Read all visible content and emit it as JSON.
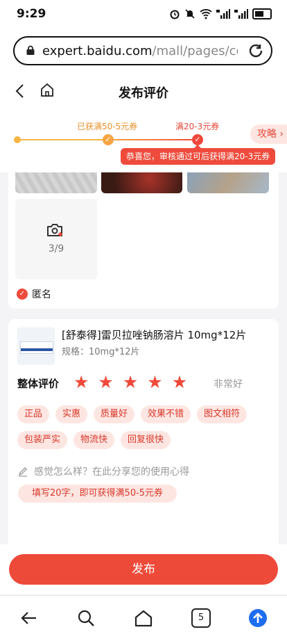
{
  "status_bar": {
    "time": "9:29",
    "icons": [
      "alarm-icon",
      "mute-icon",
      "wifi-icon",
      "signal-4g-icon",
      "signal-4g-icon",
      "battery-icon"
    ]
  },
  "browser": {
    "url_domain": "expert.baidu.com",
    "url_path": "/mall/pages/com"
  },
  "header": {
    "title": "发布评价"
  },
  "progress": {
    "label_1": "已获满50-5元券",
    "label_2": "满20-3元券",
    "tip": "恭喜您，审核通过可后获得满20-3元券",
    "guide": "攻略",
    "guide_arrow": "›",
    "check": "✓"
  },
  "upload": {
    "count": "3/9"
  },
  "anonymous": {
    "label": "匿名",
    "check": "✓"
  },
  "product": {
    "name": "[舒泰得]雷贝拉唑钠肠溶片 10mg*12片",
    "spec": "规格：10mg*12片"
  },
  "rating": {
    "label": "整体评价",
    "stars": 5,
    "star_glyph": "★",
    "text": "非常好"
  },
  "tags": [
    "正品",
    "实惠",
    "质量好",
    "效果不错",
    "图文相符",
    "包装严实",
    "物流快",
    "回复很快"
  ],
  "review": {
    "placeholder": "感觉怎么样？在此分享您的使用心得",
    "coupon_hint": "填写20字，即可获得满50-5元券"
  },
  "publish": {
    "label": "发布"
  },
  "nav": {
    "tabs_count": "5"
  },
  "colors": {
    "accent": "#ee4a3a",
    "orange": "#f5a544",
    "tag_bg": "#fde6e2"
  }
}
